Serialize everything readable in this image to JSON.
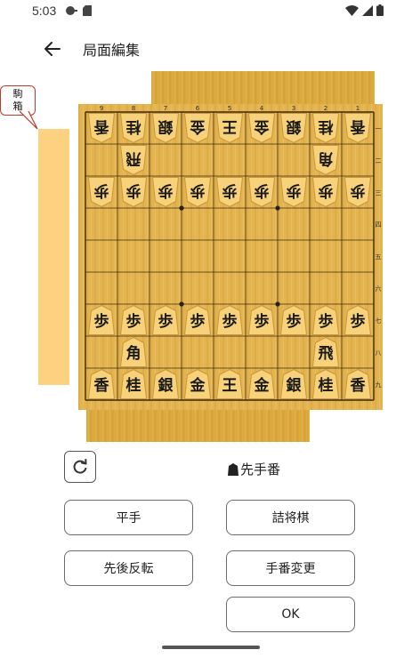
{
  "status": {
    "time": "5:03"
  },
  "app_bar": {
    "title": "局面編集"
  },
  "piece_box": {
    "label_line1": "駒",
    "label_line2": "箱"
  },
  "board": {
    "files": [
      "9",
      "8",
      "7",
      "6",
      "5",
      "4",
      "3",
      "2",
      "1"
    ],
    "ranks": [
      "一",
      "二",
      "三",
      "四",
      "五",
      "六",
      "七",
      "八",
      "九"
    ],
    "pieces": [
      {
        "f": 9,
        "r": 1,
        "k": "香",
        "s": "gote"
      },
      {
        "f": 8,
        "r": 1,
        "k": "桂",
        "s": "gote"
      },
      {
        "f": 7,
        "r": 1,
        "k": "銀",
        "s": "gote"
      },
      {
        "f": 6,
        "r": 1,
        "k": "金",
        "s": "gote"
      },
      {
        "f": 5,
        "r": 1,
        "k": "王",
        "s": "gote"
      },
      {
        "f": 4,
        "r": 1,
        "k": "金",
        "s": "gote"
      },
      {
        "f": 3,
        "r": 1,
        "k": "銀",
        "s": "gote"
      },
      {
        "f": 2,
        "r": 1,
        "k": "桂",
        "s": "gote"
      },
      {
        "f": 1,
        "r": 1,
        "k": "香",
        "s": "gote"
      },
      {
        "f": 8,
        "r": 2,
        "k": "飛",
        "s": "gote"
      },
      {
        "f": 2,
        "r": 2,
        "k": "角",
        "s": "gote"
      },
      {
        "f": 9,
        "r": 3,
        "k": "歩",
        "s": "gote"
      },
      {
        "f": 8,
        "r": 3,
        "k": "歩",
        "s": "gote"
      },
      {
        "f": 7,
        "r": 3,
        "k": "歩",
        "s": "gote"
      },
      {
        "f": 6,
        "r": 3,
        "k": "歩",
        "s": "gote"
      },
      {
        "f": 5,
        "r": 3,
        "k": "歩",
        "s": "gote"
      },
      {
        "f": 4,
        "r": 3,
        "k": "歩",
        "s": "gote"
      },
      {
        "f": 3,
        "r": 3,
        "k": "歩",
        "s": "gote"
      },
      {
        "f": 2,
        "r": 3,
        "k": "歩",
        "s": "gote"
      },
      {
        "f": 1,
        "r": 3,
        "k": "歩",
        "s": "gote"
      },
      {
        "f": 9,
        "r": 7,
        "k": "歩",
        "s": "sente"
      },
      {
        "f": 8,
        "r": 7,
        "k": "歩",
        "s": "sente"
      },
      {
        "f": 7,
        "r": 7,
        "k": "歩",
        "s": "sente"
      },
      {
        "f": 6,
        "r": 7,
        "k": "歩",
        "s": "sente"
      },
      {
        "f": 5,
        "r": 7,
        "k": "歩",
        "s": "sente"
      },
      {
        "f": 4,
        "r": 7,
        "k": "歩",
        "s": "sente"
      },
      {
        "f": 3,
        "r": 7,
        "k": "歩",
        "s": "sente"
      },
      {
        "f": 2,
        "r": 7,
        "k": "歩",
        "s": "sente"
      },
      {
        "f": 1,
        "r": 7,
        "k": "歩",
        "s": "sente"
      },
      {
        "f": 8,
        "r": 8,
        "k": "角",
        "s": "sente"
      },
      {
        "f": 2,
        "r": 8,
        "k": "飛",
        "s": "sente"
      },
      {
        "f": 9,
        "r": 9,
        "k": "香",
        "s": "sente"
      },
      {
        "f": 8,
        "r": 9,
        "k": "桂",
        "s": "sente"
      },
      {
        "f": 7,
        "r": 9,
        "k": "銀",
        "s": "sente"
      },
      {
        "f": 6,
        "r": 9,
        "k": "金",
        "s": "sente"
      },
      {
        "f": 5,
        "r": 9,
        "k": "王",
        "s": "sente"
      },
      {
        "f": 4,
        "r": 9,
        "k": "金",
        "s": "sente"
      },
      {
        "f": 3,
        "r": 9,
        "k": "銀",
        "s": "sente"
      },
      {
        "f": 2,
        "r": 9,
        "k": "桂",
        "s": "sente"
      },
      {
        "f": 1,
        "r": 9,
        "k": "香",
        "s": "sente"
      }
    ]
  },
  "turn": {
    "label": "先手番"
  },
  "buttons": {
    "hirate": "平手",
    "tsume": "詰将棋",
    "flip": "先後反転",
    "turn_change": "手番変更",
    "ok": "OK"
  },
  "colors": {
    "board_wood": "#e3b450",
    "piece_face": "#f8d27a",
    "piece_edge": "#c9973a",
    "piece_box": "#fcd280"
  }
}
